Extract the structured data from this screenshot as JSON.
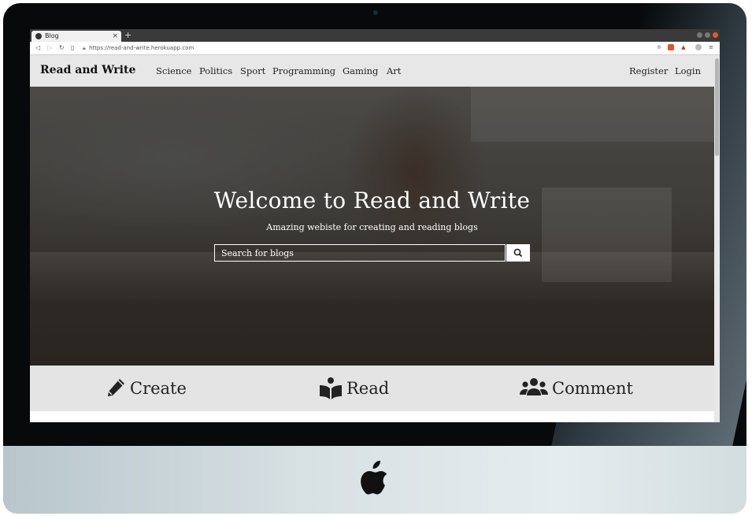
{
  "browser": {
    "tab_title": "Blog",
    "tab_close": "×",
    "new_tab": "+",
    "url": "https://read-and-write.herokuapp.com"
  },
  "site": {
    "brand": "Read and Write",
    "nav_links": [
      "Science",
      "Politics",
      "Sport",
      "Programming",
      "Gaming",
      "Art"
    ],
    "auth_links": [
      "Register",
      "Login"
    ]
  },
  "hero": {
    "title": "Welcome to Read and Write",
    "subtitle": "Amazing webiste for creating and reading blogs",
    "search_placeholder": "Search for blogs"
  },
  "features": [
    {
      "label": "Create",
      "icon": "pencil-icon"
    },
    {
      "label": "Read",
      "icon": "open-book-icon"
    },
    {
      "label": "Comment",
      "icon": "users-icon"
    }
  ],
  "colors": {
    "nav_bg": "#e7e7e7",
    "features_bg": "#e4e4e4",
    "bezel": "#07090a"
  }
}
